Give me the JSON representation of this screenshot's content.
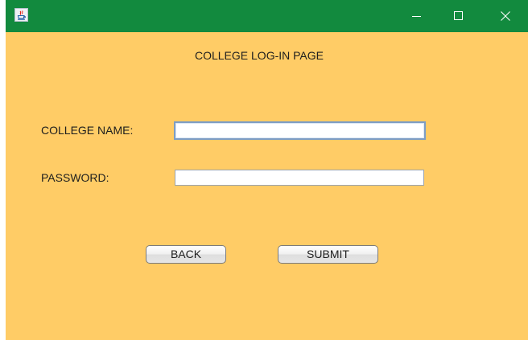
{
  "window": {
    "title": "",
    "titlebar_color": "#128a3e",
    "background_color": "#ffcc66",
    "icons": {
      "app": "java-app-icon",
      "minimize": "minimize-icon",
      "maximize": "maximize-icon",
      "close": "close-icon"
    }
  },
  "page": {
    "title": "COLLEGE LOG-IN PAGE"
  },
  "form": {
    "college_name_label": "COLLEGE NAME:",
    "college_name_value": "",
    "password_label": "PASSWORD:",
    "password_value": ""
  },
  "buttons": {
    "back_label": "BACK",
    "submit_label": "SUBMIT"
  }
}
